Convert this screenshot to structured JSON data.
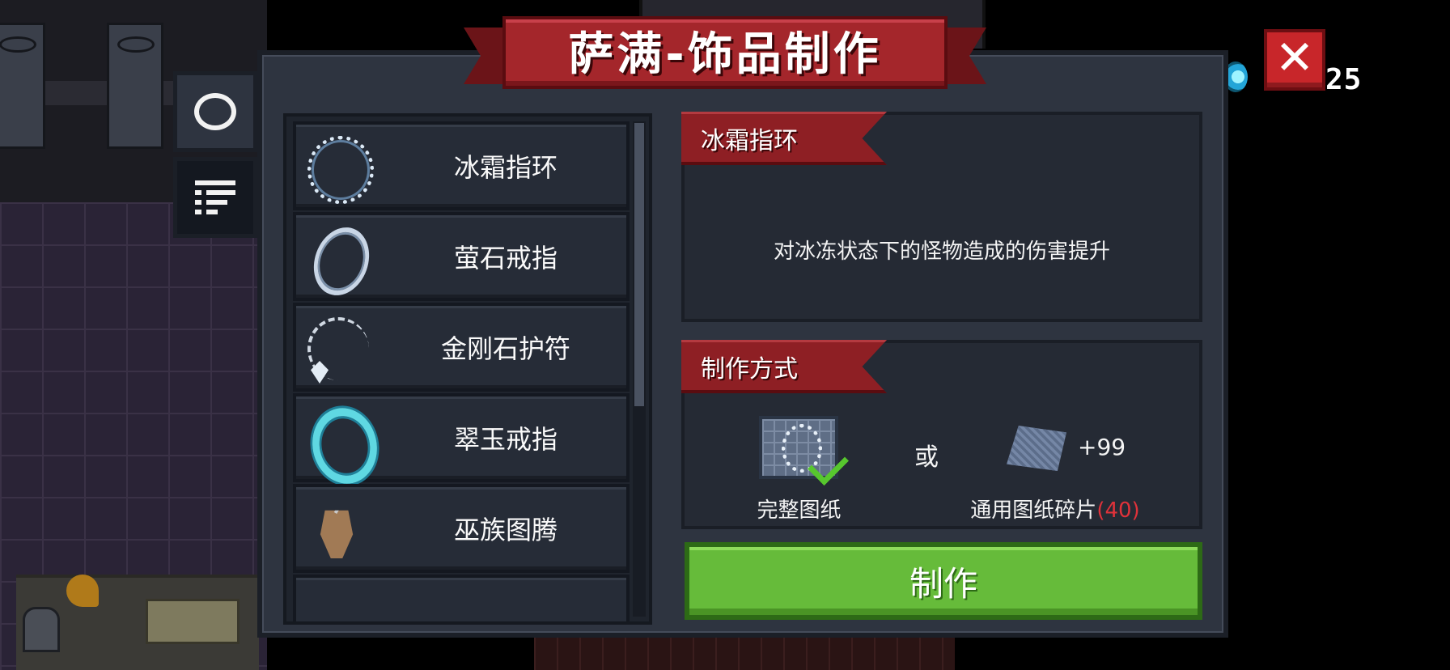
{
  "title": "萨满-饰品制作",
  "currency": {
    "icon": "gem-icon",
    "count": "25"
  },
  "close_icon_glyph": "✕",
  "tabs": [
    {
      "name": "ring-tab-icon"
    },
    {
      "name": "list-tab-icon"
    }
  ],
  "items": [
    {
      "name": "冰霜指环",
      "icon": "frost-ring-icon"
    },
    {
      "name": "萤石戒指",
      "icon": "opal-ring-icon"
    },
    {
      "name": "金刚石护符",
      "icon": "diamond-amulet-icon"
    },
    {
      "name": "翠玉戒指",
      "icon": "jade-ring-icon"
    },
    {
      "name": "巫族图腾",
      "icon": "witch-totem-icon"
    }
  ],
  "selected": {
    "name": "冰霜指环",
    "description": "对冰冻状态下的怪物造成的伤害提升"
  },
  "method": {
    "header": "制作方式",
    "blueprint_label": "完整图纸",
    "or": "或",
    "fragment_qty": "+99",
    "fragment_label": "通用图纸碎片",
    "fragment_owned": "(40)"
  },
  "craft_button": "制作",
  "colors": {
    "ribbon_red": "#a4262b",
    "panel_bg": "#2e3440",
    "craft_green": "#66bb3a",
    "warning_red": "#e0323a"
  }
}
